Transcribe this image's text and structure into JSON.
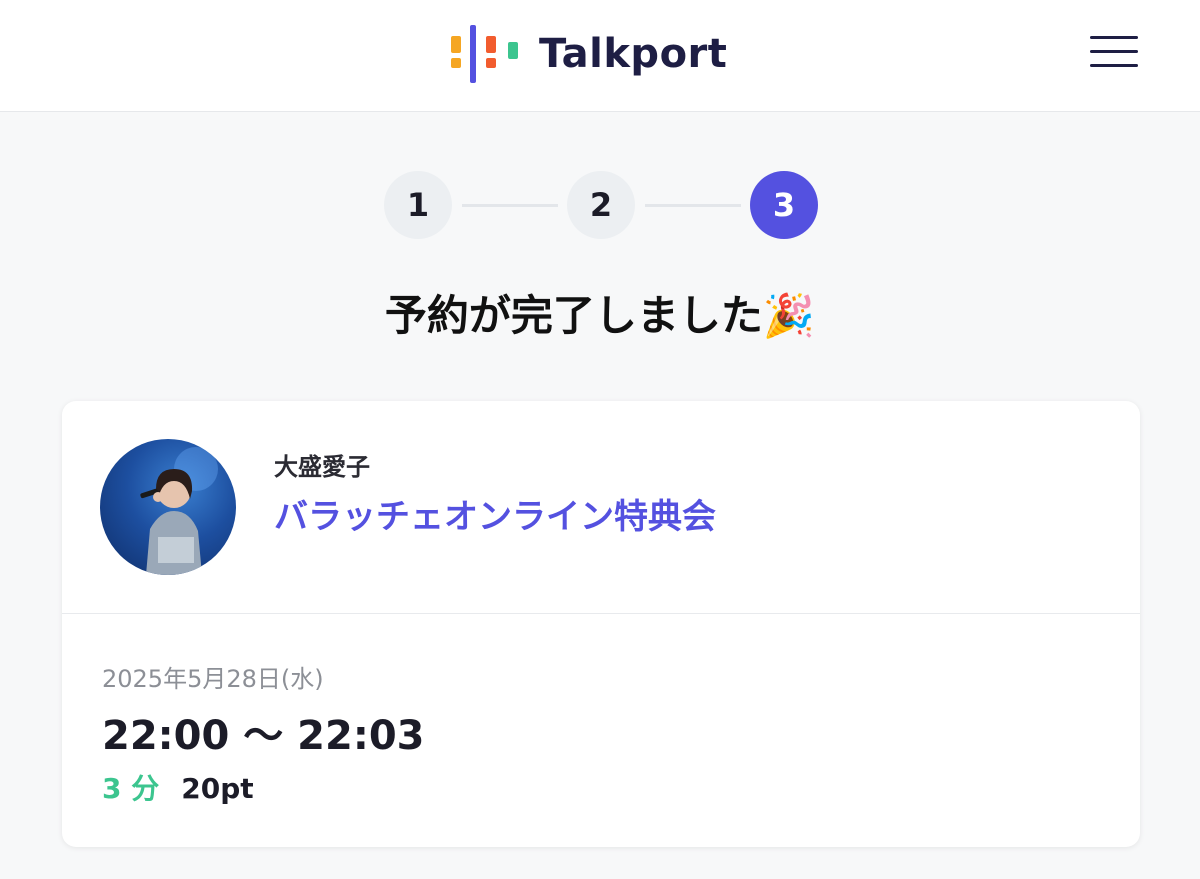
{
  "header": {
    "brand_name": "Talkport",
    "logo_colors": [
      "#f5a623",
      "#5451e0",
      "#f25c2e",
      "#3cc58f"
    ],
    "menu_icon": "hamburger-menu-icon"
  },
  "stepper": {
    "steps": [
      "1",
      "2",
      "3"
    ],
    "current_step": 3,
    "active_color": "#5451e0"
  },
  "completion": {
    "title": "予約が完了しました🎉"
  },
  "reservation": {
    "talent_name": "大盛愛子",
    "event_name": "バラッチェオンライン特典会",
    "date": "2025年5月28日(水)",
    "time_range": "22:00 〜 22:03",
    "duration": "3 分",
    "points": "20pt",
    "duration_color": "#3cc58f"
  }
}
